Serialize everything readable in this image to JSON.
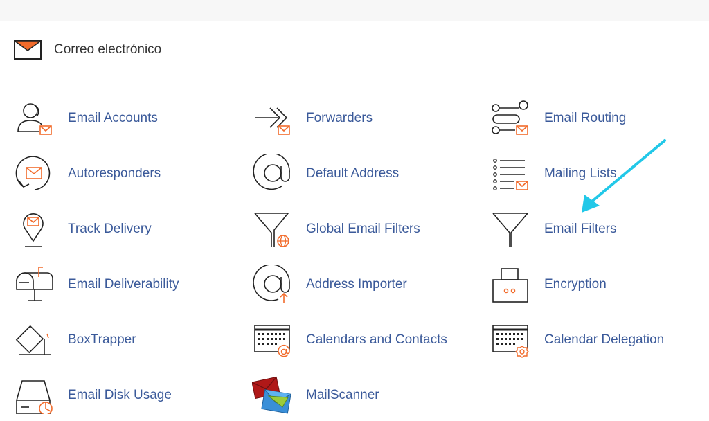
{
  "section": {
    "title": "Correo electrónico",
    "icon": "envelope-icon"
  },
  "items": [
    {
      "label": "Email Accounts",
      "icon": "user-mail-icon"
    },
    {
      "label": "Forwarders",
      "icon": "forward-arrow-icon"
    },
    {
      "label": "Email Routing",
      "icon": "routing-icon"
    },
    {
      "label": "Autoresponders",
      "icon": "autoresponder-icon"
    },
    {
      "label": "Default Address",
      "icon": "at-sign-icon"
    },
    {
      "label": "Mailing Lists",
      "icon": "list-icon"
    },
    {
      "label": "Track Delivery",
      "icon": "location-pin-icon"
    },
    {
      "label": "Global Email Filters",
      "icon": "funnel-globe-icon"
    },
    {
      "label": "Email Filters",
      "icon": "funnel-icon"
    },
    {
      "label": "Email Deliverability",
      "icon": "mailbox-icon"
    },
    {
      "label": "Address Importer",
      "icon": "at-import-icon"
    },
    {
      "label": "Encryption",
      "icon": "lock-icon"
    },
    {
      "label": "BoxTrapper",
      "icon": "trap-icon"
    },
    {
      "label": "Calendars and Contacts",
      "icon": "calendar-at-icon"
    },
    {
      "label": "Calendar Delegation",
      "icon": "calendar-gear-icon"
    },
    {
      "label": "Email Disk Usage",
      "icon": "disk-pie-icon"
    },
    {
      "label": "MailScanner",
      "icon": "mailscanner-envelopes-icon"
    }
  ],
  "colors": {
    "accent": "#f26b2b",
    "link": "#3b5a9a",
    "annotation": "#22c8e8"
  }
}
